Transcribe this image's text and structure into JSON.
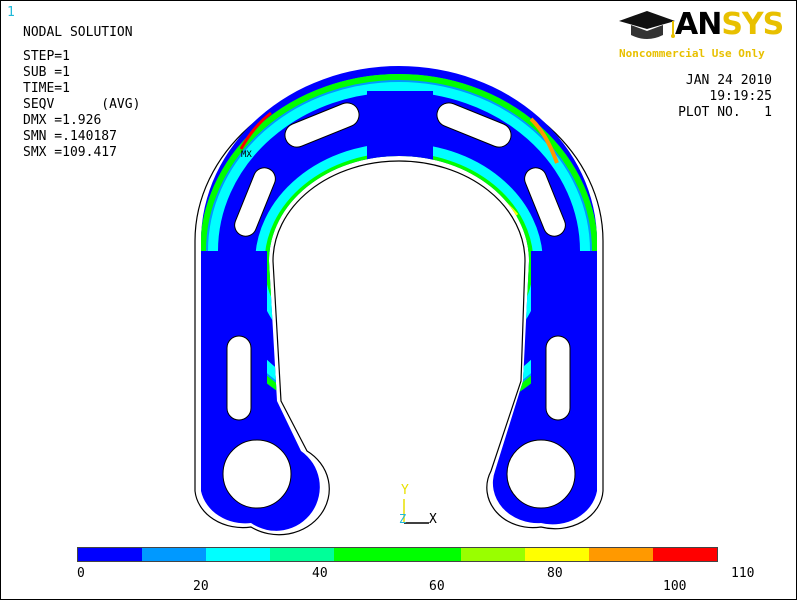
{
  "window_number": "1",
  "info": {
    "title": "NODAL SOLUTION",
    "step": "STEP=1",
    "sub": "SUB =1",
    "time": "TIME=1",
    "result": "SEQV      (AVG)",
    "dmx": "DMX =1.926",
    "smn": "SMN =.140187",
    "smx": "SMX =109.417"
  },
  "logo": {
    "brand_a": "AN",
    "brand_b": "SYS",
    "sub": "Noncommercial Use Only",
    "icon": "graduation-cap-icon"
  },
  "header_right": {
    "date": "JAN 24 2010",
    "time": "19:19:25",
    "plot": "PLOT NO.   1"
  },
  "triad": {
    "y": "Y",
    "z": "Z",
    "x": "X"
  },
  "markers": {
    "mx": "MX"
  },
  "legend": {
    "colors": [
      "#0000ff",
      "#0099ff",
      "#00ffff",
      "#00ff99",
      "#00ff00",
      "#00ff00",
      "#99ff00",
      "#ffff00",
      "#ff9900",
      "#ff0000"
    ],
    "bottom_labels": [
      "0",
      "20",
      "40",
      "60",
      "80",
      "100"
    ],
    "top_labels": [
      "110"
    ]
  },
  "colors": {
    "blue": "#0000ff",
    "lightblue": "#0099ff",
    "cyan": "#00ffff",
    "teal": "#00ff99",
    "green": "#00ff00",
    "yellowgreen": "#99ff00",
    "yellow": "#ffff00",
    "orange": "#ff9900",
    "red": "#ff0000"
  }
}
